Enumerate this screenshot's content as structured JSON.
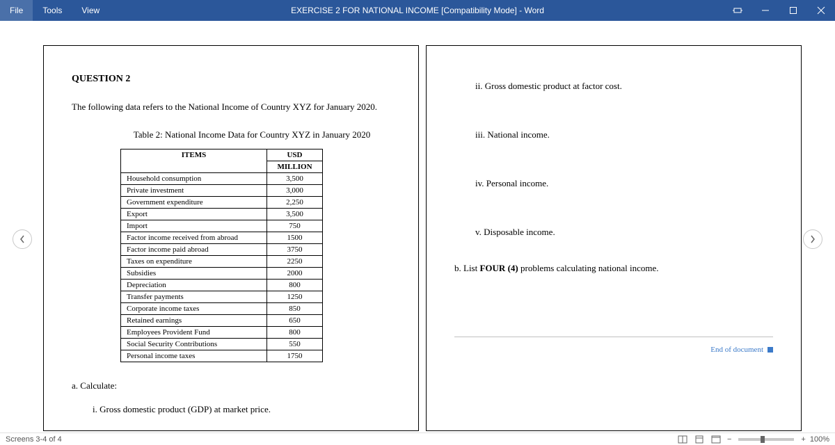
{
  "menu": {
    "file": "File",
    "tools": "Tools",
    "view": "View"
  },
  "title": "EXERCISE 2 FOR NATIONAL INCOME [Compatibility Mode] - Word",
  "doc": {
    "question_heading": "QUESTION 2",
    "intro": "The following data refers to the National Income of Country XYZ for January 2020.",
    "table_caption": "Table 2: National Income Data for Country XYZ in January 2020",
    "col_items": "ITEMS",
    "col_usd_1": "USD",
    "col_usd_2": "MILLION",
    "rows": [
      {
        "item": "Household consumption",
        "val": "3,500"
      },
      {
        "item": "Private investment",
        "val": "3,000"
      },
      {
        "item": "Government expenditure",
        "val": "2,250"
      },
      {
        "item": "Export",
        "val": "3,500"
      },
      {
        "item": "Import",
        "val": "750"
      },
      {
        "item": "Factor income received from abroad",
        "val": "1500"
      },
      {
        "item": "Factor income paid abroad",
        "val": "3750"
      },
      {
        "item": "Taxes on expenditure",
        "val": "2250"
      },
      {
        "item": "Subsidies",
        "val": "2000"
      },
      {
        "item": "Depreciation",
        "val": "800"
      },
      {
        "item": "Transfer payments",
        "val": "1250"
      },
      {
        "item": "Corporate income taxes",
        "val": "850"
      },
      {
        "item": "Retained earnings",
        "val": "650"
      },
      {
        "item": "Employees Provident Fund",
        "val": "800"
      },
      {
        "item": "Social Security Contributions",
        "val": "550"
      },
      {
        "item": "Personal income taxes",
        "val": "1750"
      }
    ],
    "a_label": "a. Calculate:",
    "i_label": "i. Gross domestic product (GDP) at market price.",
    "ii_label": "ii. Gross domestic product at factor cost.",
    "iii_label": "iii. National income.",
    "iv_label": "iv. Personal income.",
    "v_label": "v. Disposable income.",
    "b_label_prefix": "b. List ",
    "b_label_bold": "FOUR (4)",
    "b_label_suffix": " problems calculating national income.",
    "end_doc": "End of document"
  },
  "status": {
    "screens": "Screens 3-4 of 4",
    "zoom": "100%"
  }
}
